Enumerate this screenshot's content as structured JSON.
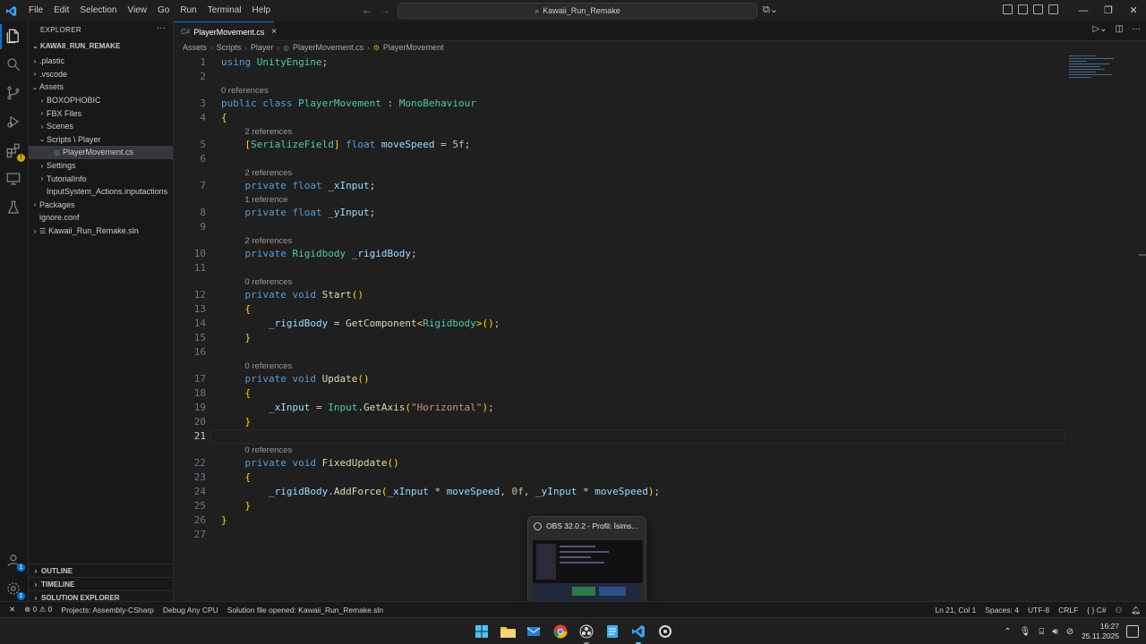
{
  "menu": [
    "File",
    "Edit",
    "Selection",
    "View",
    "Go",
    "Run",
    "Terminal",
    "Help"
  ],
  "command_center": "Kawaii_Run_Remake",
  "explorer": {
    "title": "EXPLORER",
    "root": "KAWAII_RUN_REMAKE",
    "items": [
      {
        "label": ".plastic",
        "indent": 1,
        "chev": "›"
      },
      {
        "label": ".vscode",
        "indent": 1,
        "chev": "›"
      },
      {
        "label": "Assets",
        "indent": 1,
        "chev": "⌄"
      },
      {
        "label": "BOXOPHOBIC",
        "indent": 2,
        "chev": "›"
      },
      {
        "label": "FBX Files",
        "indent": 2,
        "chev": "›"
      },
      {
        "label": "Scenes",
        "indent": 2,
        "chev": "›"
      },
      {
        "label": "Scripts \\ Player",
        "indent": 2,
        "chev": "⌄"
      },
      {
        "label": "PlayerMovement.cs",
        "indent": 3,
        "chev": "",
        "icon": "cs",
        "selected": true
      },
      {
        "label": "Settings",
        "indent": 2,
        "chev": "›"
      },
      {
        "label": "TutorialInfo",
        "indent": 2,
        "chev": "›"
      },
      {
        "label": "InputSystem_Actions.inputactions",
        "indent": 2,
        "chev": ""
      },
      {
        "label": "Packages",
        "indent": 1,
        "chev": "›"
      },
      {
        "label": "ignore.conf",
        "indent": 1,
        "chev": ""
      },
      {
        "label": "Kawaii_Run_Remake.sln",
        "indent": 1,
        "chev": "›",
        "icon": "sln"
      }
    ],
    "sections": [
      "OUTLINE",
      "TIMELINE",
      "SOLUTION EXPLORER"
    ]
  },
  "tab": {
    "label": "PlayerMovement.cs",
    "close": "×"
  },
  "breadcrumb": [
    "Assets",
    "Scripts",
    "Player",
    "PlayerMovement.cs",
    "PlayerMovement"
  ],
  "editor": {
    "current_line": 21,
    "lenses": {
      "3": "0 references",
      "5": "2 references",
      "7": "2 references",
      "8": "1 reference",
      "10": "2 references",
      "12": "0 references",
      "17": "0 references",
      "22": "0 references"
    },
    "lines": [
      "using UnityEngine;",
      "",
      "public class PlayerMovement : MonoBehaviour",
      "{",
      "    [SerializeField] float moveSpeed = 5f;",
      "",
      "    private float _xInput;",
      "    private float _yInput;",
      "",
      "    private Rigidbody _rigidBody;",
      "",
      "    private void Start()",
      "    {",
      "        _rigidBody = GetComponent<Rigidbody>();",
      "    }",
      "",
      "    private void Update()",
      "    {",
      "        _xInput = Input.GetAxis(\"Horizontal\");",
      "    }",
      "",
      "    private void FixedUpdate()",
      "    {",
      "        _rigidBody.AddForce(_xInput * moveSpeed, 0f, _yInput * moveSpeed);",
      "    }",
      "}",
      ""
    ]
  },
  "statusbar": {
    "remote": "✕",
    "problems": "⊗ 0 ⚠ 0",
    "projects": "Projects: Assembly-CSharp",
    "debug": "Debug Any CPU",
    "solution": "Solution file opened: Kawaii_Run_Remake.sln",
    "position": "Ln 21, Col 1",
    "spaces": "Spaces: 4",
    "encoding": "UTF-8",
    "eol": "CRLF",
    "language": "{ } C#"
  },
  "obs_popup": {
    "title": "OBS 32.0.2 - Profil: İsims..."
  },
  "taskbar": {
    "time": "16:27",
    "date": "25.11.2025"
  },
  "colors": {
    "accent": "#0078d4",
    "bg": "#1f1f1f",
    "sidebar": "#181818"
  }
}
